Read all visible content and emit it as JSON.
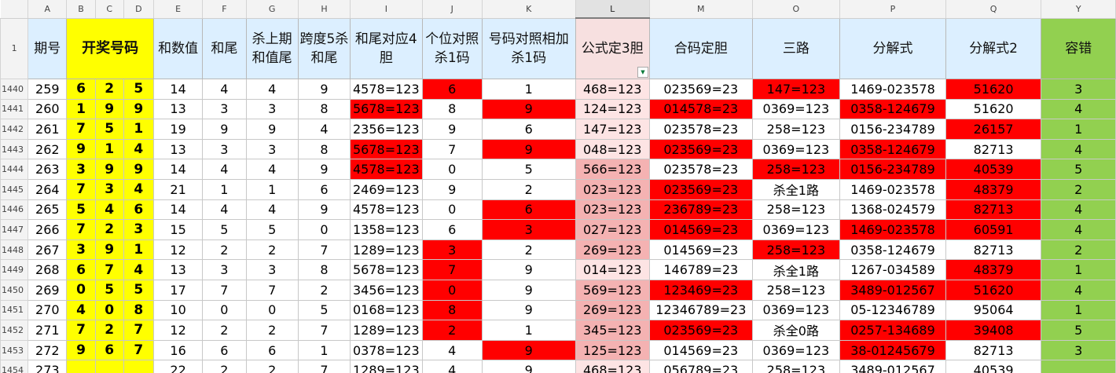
{
  "columns": [
    "A",
    "B",
    "C",
    "D",
    "E",
    "F",
    "G",
    "H",
    "I",
    "J",
    "K",
    "L",
    "M",
    "O",
    "P",
    "Q",
    "Y"
  ],
  "header": {
    "row_num": "1",
    "qihao": "期号",
    "kaijiang": "开奖号码",
    "hsz": "和数值",
    "hw": "和尾",
    "shaShang": "杀上期和值尾",
    "kd5": "跨度5杀和尾",
    "hwdy": "和尾对应4胆",
    "gwdz": "个位对照杀1码",
    "hmdz": "号码对照相加杀1码",
    "gsd3": "公式定3胆",
    "hmdd": "合码定胆",
    "sanlu": "三路",
    "fjs": "分解式",
    "fjs2": "分解式2",
    "rongcuo": "容错"
  },
  "rows": [
    {
      "rn": "1440",
      "qh": "259",
      "b": "6",
      "c": "2",
      "d": "5",
      "e": "14",
      "f": "4",
      "g": "4",
      "h": "9",
      "i": "4578=123",
      "j": "6",
      "k": "1",
      "l": "468=123",
      "m": "023569=23",
      "o": "147=123",
      "p": "1469-023578",
      "q": "51620",
      "y": "3"
    },
    {
      "rn": "1441",
      "qh": "260",
      "b": "1",
      "c": "9",
      "d": "9",
      "e": "13",
      "f": "3",
      "g": "3",
      "h": "8",
      "i": "5678=123",
      "j": "8",
      "k": "9",
      "l": "124=123",
      "m": "014578=23",
      "o": "0369=123",
      "p": "0358-124679",
      "q": "51620",
      "y": "4"
    },
    {
      "rn": "1442",
      "qh": "261",
      "b": "7",
      "c": "5",
      "d": "1",
      "e": "19",
      "f": "9",
      "g": "9",
      "h": "4",
      "i": "2356=123",
      "j": "9",
      "k": "6",
      "l": "147=123",
      "m": "023578=23",
      "o": "258=123",
      "p": "0156-234789",
      "q": "26157",
      "y": "1"
    },
    {
      "rn": "1443",
      "qh": "262",
      "b": "9",
      "c": "1",
      "d": "4",
      "e": "13",
      "f": "3",
      "g": "3",
      "h": "8",
      "i": "5678=123",
      "j": "7",
      "k": "9",
      "l": "048=123",
      "m": "023569=23",
      "o": "0369=123",
      "p": "0358-124679",
      "q": "82713",
      "y": "4"
    },
    {
      "rn": "1444",
      "qh": "263",
      "b": "3",
      "c": "9",
      "d": "9",
      "e": "14",
      "f": "4",
      "g": "4",
      "h": "9",
      "i": "4578=123",
      "j": "0",
      "k": "5",
      "l": "566=123",
      "m": "023578=23",
      "o": "258=123",
      "p": "0156-234789",
      "q": "40539",
      "y": "5"
    },
    {
      "rn": "1445",
      "qh": "264",
      "b": "7",
      "c": "3",
      "d": "4",
      "e": "21",
      "f": "1",
      "g": "1",
      "h": "6",
      "i": "2469=123",
      "j": "9",
      "k": "2",
      "l": "023=123",
      "m": "023569=23",
      "o": "杀全1路",
      "p": "1469-023578",
      "q": "48379",
      "y": "2"
    },
    {
      "rn": "1446",
      "qh": "265",
      "b": "5",
      "c": "4",
      "d": "6",
      "e": "14",
      "f": "4",
      "g": "4",
      "h": "9",
      "i": "4578=123",
      "j": "0",
      "k": "6",
      "l": "023=123",
      "m": "236789=23",
      "o": "258=123",
      "p": "1368-024579",
      "q": "82713",
      "y": "4"
    },
    {
      "rn": "1447",
      "qh": "266",
      "b": "7",
      "c": "2",
      "d": "3",
      "e": "15",
      "f": "5",
      "g": "5",
      "h": "0",
      "i": "1358=123",
      "j": "6",
      "k": "3",
      "l": "027=123",
      "m": "014569=23",
      "o": "0369=123",
      "p": "1469-023578",
      "q": "60591",
      "y": "4"
    },
    {
      "rn": "1448",
      "qh": "267",
      "b": "3",
      "c": "9",
      "d": "1",
      "e": "12",
      "f": "2",
      "g": "2",
      "h": "7",
      "i": "1289=123",
      "j": "3",
      "k": "2",
      "l": "269=123",
      "m": "014569=23",
      "o": "258=123",
      "p": "0358-124679",
      "q": "82713",
      "y": "2"
    },
    {
      "rn": "1449",
      "qh": "268",
      "b": "6",
      "c": "7",
      "d": "4",
      "e": "13",
      "f": "3",
      "g": "3",
      "h": "8",
      "i": "5678=123",
      "j": "7",
      "k": "9",
      "l": "014=123",
      "m": "146789=23",
      "o": "杀全1路",
      "p": "1267-034589",
      "q": "48379",
      "y": "1"
    },
    {
      "rn": "1450",
      "qh": "269",
      "b": "0",
      "c": "5",
      "d": "5",
      "e": "17",
      "f": "7",
      "g": "7",
      "h": "2",
      "i": "3456=123",
      "j": "0",
      "k": "9",
      "l": "569=123",
      "m": "123469=23",
      "o": "258=123",
      "p": "3489-012567",
      "q": "51620",
      "y": "4"
    },
    {
      "rn": "1451",
      "qh": "270",
      "b": "4",
      "c": "0",
      "d": "8",
      "e": "10",
      "f": "0",
      "g": "0",
      "h": "5",
      "i": "0168=123",
      "j": "8",
      "k": "9",
      "l": "269=123",
      "m": "12346789=23",
      "o": "0369=123",
      "p": "05-12346789",
      "q": "95064",
      "y": "1"
    },
    {
      "rn": "1452",
      "qh": "271",
      "b": "7",
      "c": "2",
      "d": "7",
      "e": "12",
      "f": "2",
      "g": "2",
      "h": "7",
      "i": "1289=123",
      "j": "2",
      "k": "1",
      "l": "345=123",
      "m": "023569=23",
      "o": "杀全0路",
      "p": "0257-134689",
      "q": "39408",
      "y": "5"
    },
    {
      "rn": "1453",
      "qh": "272",
      "b": "9",
      "c": "6",
      "d": "7",
      "e": "16",
      "f": "6",
      "g": "6",
      "h": "1",
      "i": "0378=123",
      "j": "4",
      "k": "9",
      "l": "125=123",
      "m": "014569=23",
      "o": "0369=123",
      "p": "38-01245679",
      "q": "82713",
      "y": "3"
    },
    {
      "rn": "1454",
      "qh": "273",
      "b": "",
      "c": "",
      "d": "",
      "e": "22",
      "f": "2",
      "g": "2",
      "h": "7",
      "i": "1289=123",
      "j": "4",
      "k": "9",
      "l": "468=123",
      "m": "056789=23",
      "o": "258=123",
      "p": "3489-012567",
      "q": "40539",
      "y": ""
    }
  ],
  "colors": {
    "red": "#ff0000",
    "yellow": "#ffff00",
    "green": "#92d050",
    "pink": "#fde4e4",
    "header_blue": "#dcefff"
  },
  "highlights": {
    "i": [
      "1441",
      "1443",
      "1444"
    ],
    "j": [
      "1440",
      "1448",
      "1449",
      "1450",
      "1451",
      "1452"
    ],
    "k": [
      "1441",
      "1443",
      "1446",
      "1447",
      "1453"
    ],
    "l_dark": [
      "1444",
      "1445",
      "1446",
      "1447",
      "1448",
      "1450",
      "1451",
      "1452",
      "1453"
    ],
    "m": [
      "1441",
      "1443",
      "1445",
      "1446",
      "1447",
      "1450",
      "1452"
    ],
    "o": [
      "1440",
      "1444",
      "1448"
    ],
    "p": [
      "1441",
      "1443",
      "1444",
      "1447",
      "1450",
      "1452",
      "1453"
    ],
    "q": [
      "1440",
      "1442",
      "1444",
      "1445",
      "1446",
      "1447",
      "1449",
      "1450",
      "1452"
    ]
  }
}
